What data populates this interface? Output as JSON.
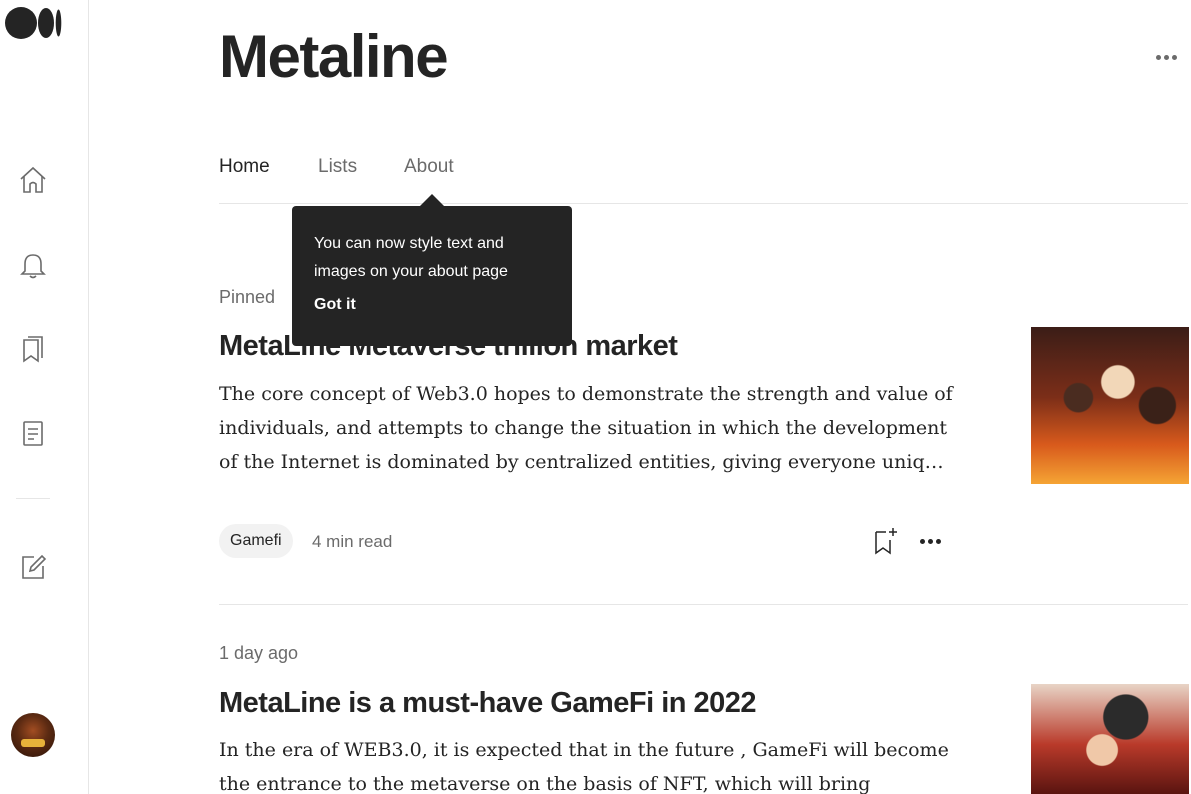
{
  "publication": {
    "title": "Metaline"
  },
  "tabs": [
    {
      "label": "Home",
      "active": true
    },
    {
      "label": "Lists",
      "active": false
    },
    {
      "label": "About",
      "active": false
    }
  ],
  "tooltip": {
    "text": "You can now style text and images on your about page",
    "button": "Got it"
  },
  "articles": [
    {
      "meta": "Pinned",
      "title": "MetaLine Metaverse trillion market",
      "subtitle": "The core concept of Web3.0 hopes to demonstrate the strength and value of individuals, and attempts to change the situation in which the development of the Internet is dominated by centralized entities, giving everyone uniq…",
      "tag": "Gamefi",
      "read_time": "4 min read"
    },
    {
      "meta": "1 day ago",
      "title": "MetaLine is a must-have GameFi in 2022",
      "subtitle": "In the era of WEB3.0, it is expected that in the future , GameFi will become the entrance to the metaverse on the basis of NFT, which will bring"
    }
  ],
  "icons": {
    "logo": "medium-logo-icon",
    "rail": [
      "home-icon",
      "bell-icon",
      "bookmarks-icon",
      "stories-icon",
      "write-icon"
    ],
    "more": "more-horizontal-icon",
    "save": "bookmark-add-icon"
  },
  "colors": {
    "text": "#242424",
    "muted": "#6b6b6b",
    "tooltip_bg": "#242424",
    "tag_bg": "#f2f2f2",
    "border": "#e6e6e6"
  }
}
